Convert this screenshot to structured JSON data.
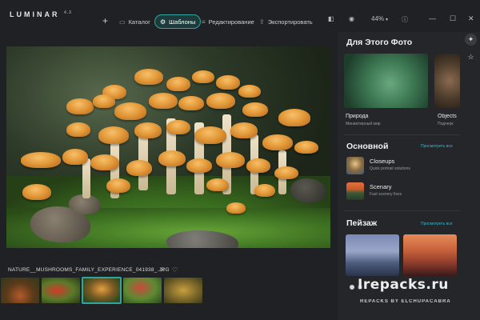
{
  "app": {
    "logo": "LUMINAR",
    "logo_version": "4.3"
  },
  "toolbar": {
    "add_label": "+",
    "catalog_label": "Каталог",
    "templates_label": "Шаблоны",
    "edit_label": "Редактирование",
    "export_label": "Экспортировать",
    "zoom_label": "44%"
  },
  "photo": {
    "filename": "NATURE__MUSHROOMS_FAMILY_EXPERIENCE_041938_.JPG"
  },
  "panel": {
    "for_photo_title": "Для Этого Фото",
    "cards": [
      {
        "label": "Природа",
        "sub": "Миниатюрный мир"
      },
      {
        "label": "Objects",
        "sub": "Подчерк"
      }
    ],
    "basic_title": "Основной",
    "view_all": "Просмотреть все",
    "items": [
      {
        "title": "Closeups",
        "sub": "Quick portrait solutions"
      },
      {
        "title": "Scenary",
        "sub": "Fast scenery fixes"
      }
    ],
    "landscape_title": "Пейзаж"
  },
  "watermark": {
    "main": "Irepacks.ru",
    "sub": "REPACKS BY ELCHUPACABRA"
  },
  "colors": {
    "accent": "#2fa5a2",
    "link": "#3fb3c9",
    "bg": "#202124",
    "panel": "#25262a"
  }
}
